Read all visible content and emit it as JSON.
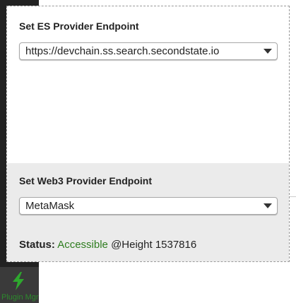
{
  "sidebar": {
    "plugin_icon": "lightning-bolt-icon",
    "plugin_label": "Plugin Mgr"
  },
  "es_provider": {
    "label": "Set ES Provider Endpoint",
    "selected": "https://devchain.ss.search.secondstate.io"
  },
  "web3_provider": {
    "label": "Set Web3 Provider Endpoint",
    "selected": "MetaMask"
  },
  "status": {
    "label": "Status:",
    "value": "Accessible",
    "height_text": "@Height 1537816"
  },
  "colors": {
    "status_accessible": "#2e7d1f",
    "bottom_section_bg": "#ebebeb",
    "sidebar_bg": "#222222"
  }
}
